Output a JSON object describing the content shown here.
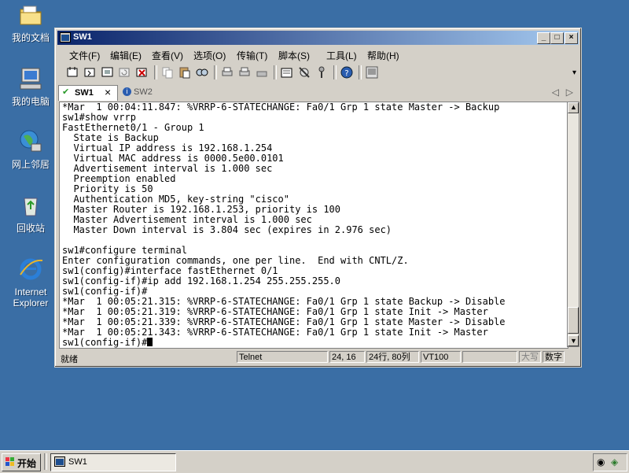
{
  "desktop": {
    "icons": [
      {
        "label": "我的文档"
      },
      {
        "label": "我的电脑"
      },
      {
        "label": "网上邻居"
      },
      {
        "label": "回收站"
      },
      {
        "label": "Internet Explorer"
      }
    ]
  },
  "window": {
    "title": "SW1",
    "menu": [
      "文件(F)",
      "编辑(E)",
      "查看(V)",
      "选项(O)",
      "传输(T)",
      "脚本(S)",
      "工具(L)",
      "帮助(H)"
    ],
    "tabs": [
      {
        "label": "SW1",
        "close": "×"
      },
      {
        "label": "SW2"
      }
    ],
    "terminal_lines": [
      "*Mar  1 00:04:11.847: %VRRP-6-STATECHANGE: Fa0/1 Grp 1 state Master -> Backup",
      "sw1#show vrrp",
      "FastEthernet0/1 - Group 1",
      "  State is Backup",
      "  Virtual IP address is 192.168.1.254",
      "  Virtual MAC address is 0000.5e00.0101",
      "  Advertisement interval is 1.000 sec",
      "  Preemption enabled",
      "  Priority is 50",
      "  Authentication MD5, key-string \"cisco\"",
      "  Master Router is 192.168.1.253, priority is 100",
      "  Master Advertisement interval is 1.000 sec",
      "  Master Down interval is 3.804 sec (expires in 2.976 sec)",
      "",
      "sw1#configure terminal",
      "Enter configuration commands, one per line.  End with CNTL/Z.",
      "sw1(config)#interface fastEthernet 0/1",
      "sw1(config-if)#ip add 192.168.1.254 255.255.255.0",
      "sw1(config-if)#",
      "*Mar  1 00:05:21.315: %VRRP-6-STATECHANGE: Fa0/1 Grp 1 state Backup -> Disable",
      "*Mar  1 00:05:21.319: %VRRP-6-STATECHANGE: Fa0/1 Grp 1 state Init -> Master",
      "*Mar  1 00:05:21.339: %VRRP-6-STATECHANGE: Fa0/1 Grp 1 state Master -> Disable",
      "*Mar  1 00:05:21.343: %VRRP-6-STATECHANGE: Fa0/1 Grp 1 state Init -> Master"
    ],
    "prompt": "sw1(config-if)#",
    "status": {
      "ready": "就绪",
      "protocol": "Telnet",
      "cursor_pos": "24, 16",
      "size": "24行, 80列",
      "emulation": "VT100",
      "caps": "大写",
      "num": "数字"
    }
  },
  "taskbar": {
    "start": "开始",
    "task": "SW1"
  }
}
